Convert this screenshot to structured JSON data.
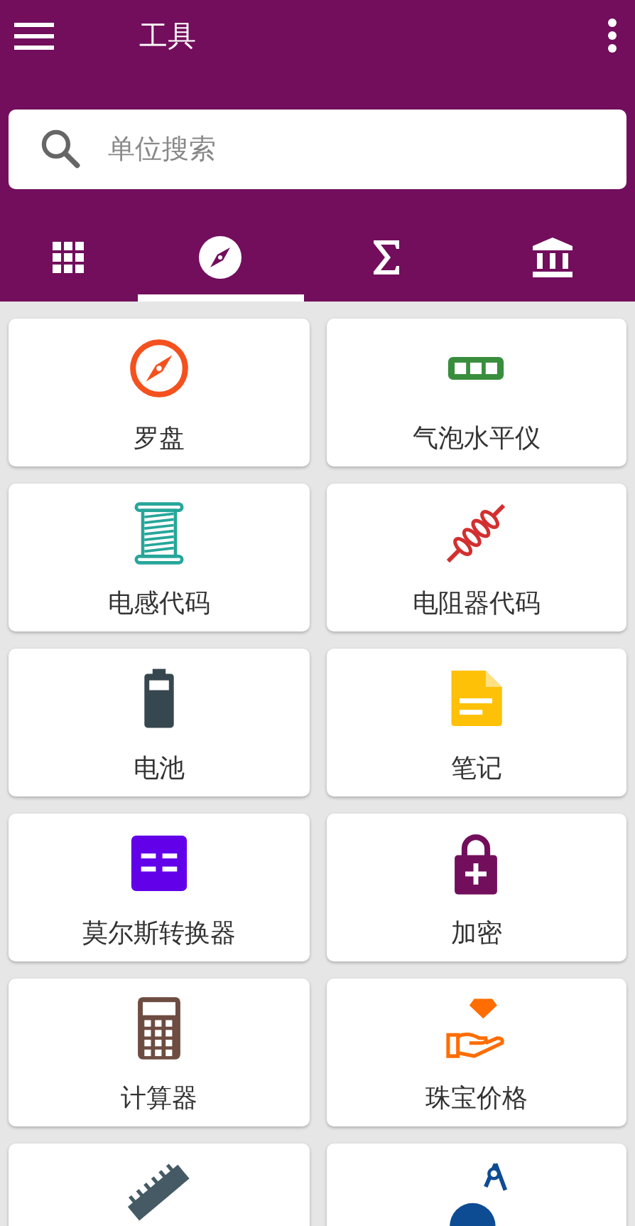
{
  "app_bar": {
    "title": "工具"
  },
  "search": {
    "placeholder": "单位搜索"
  },
  "tabs": [
    {
      "selected": false
    },
    {
      "selected": true
    },
    {
      "selected": false
    },
    {
      "selected": false
    }
  ],
  "tools": [
    {
      "label": "罗盘",
      "color": "#f4511e"
    },
    {
      "label": "气泡水平仪",
      "color": "#388e3c"
    },
    {
      "label": "电感代码",
      "color": "#26a69a"
    },
    {
      "label": "电阻器代码",
      "color": "#d32f2f"
    },
    {
      "label": "电池",
      "color": "#37474f"
    },
    {
      "label": "笔记",
      "color": "#ffc107"
    },
    {
      "label": "莫尔斯转换器",
      "color": "#6200ea"
    },
    {
      "label": "加密",
      "color": "#720e5c"
    },
    {
      "label": "计算器",
      "color": "#6d4c41"
    },
    {
      "label": "珠宝价格",
      "color": "#ff6d00"
    },
    {
      "color": "#455a64"
    },
    {
      "color": "#0d4c92"
    }
  ]
}
